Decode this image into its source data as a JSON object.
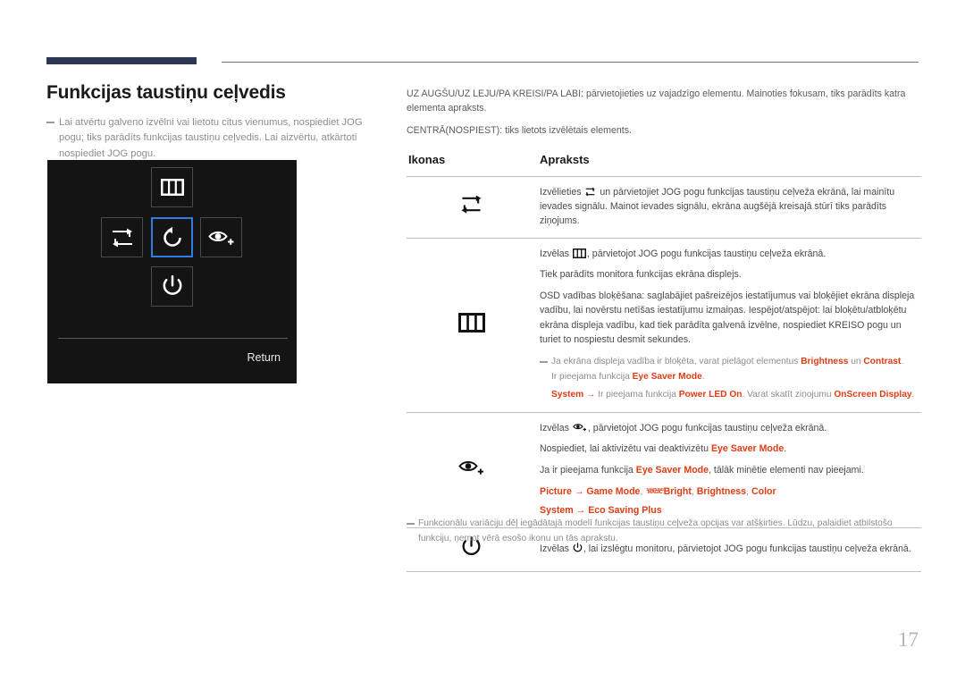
{
  "page": {
    "title": "Funkcijas taustiņu ceļvedis",
    "page_number": "17",
    "intro_note": "Lai atvērtu galveno izvēlni vai lietotu citus vienumus, nospiediet JOG pogu; tiks parādīts funkcijas taustiņu ceļvedis. Lai aizvērtu, atkārtoti nospiediet JOG pogu.",
    "accent_color": "#e03c14",
    "rule_color": "#2c3551"
  },
  "osd": {
    "return_label": "Return",
    "buttons": {
      "up": "menu-bars-icon",
      "left": "source-switch-icon",
      "center": "return-arrow-icon",
      "right": "eye-saver-icon",
      "down": "power-icon"
    },
    "highlight_color": "#2f7ddf"
  },
  "intro": {
    "line1": "UZ AUGŠU/UZ LEJU/PA KREISI/PA LABI: pārvietojieties uz vajadzīgo elementu. Mainoties fokusam, tiks parādīts katra elementa apraksts.",
    "line2": "CENTRĀ(NOSPIEST): tiks lietots izvēlētais elements."
  },
  "table": {
    "headers": {
      "icons": "Ikonas",
      "description": "Apraksts"
    },
    "rows": [
      {
        "icon": "source-switch-icon",
        "paragraphs": [
          {
            "pre": "Izvēlieties ",
            "icon": "source-switch-icon",
            "post": " un pārvietojiet JOG pogu funkcijas taustiņu ceļveža ekrānā, lai mainītu ievades signālu. Mainot ievades signālu, ekrāna augšējā kreisajā stūrī tiks parādīts ziņojums."
          }
        ]
      },
      {
        "icon": "menu-bars-icon",
        "paragraphs": [
          {
            "pre": "Izvēlas ",
            "icon": "menu-bars-icon",
            "post": ", pārvietojot JOG pogu funkcijas taustiņu ceļveža ekrānā."
          },
          {
            "text": "Tiek parādīts monitora funkcijas ekrāna displejs."
          },
          {
            "text": "OSD vadības bloķēšana: saglabājiet pašreizējos iestatījumus vai bloķējiet ekrāna displeja vadību, lai novērstu netīšas iestatījumu izmaiņas. Iespējot/atspējot: lai bloķētu/atbloķētu ekrāna displeja vadību, kad tiek parādīta galvenā izvēlne, nospiediet KREISO pogu un turiet to nospiestu desmit sekundes."
          }
        ],
        "subnote": {
          "line1_a": "Ja ekrāna displeja vadība ir bloķēta, varat pielāgot elementus ",
          "line1_hl1": "Brightness",
          "line1_b": " un ",
          "line1_hl2": "Contrast",
          "line1_c": ".",
          "line2_a": "Ir pieejama funkcija ",
          "line2_hl": "Eye Saver Mode",
          "line2_b": ".",
          "line3_hl1": "System",
          "line3_arrow": " → ",
          "line3_a": "Ir pieejama funkcija ",
          "line3_hl2": "Power LED On",
          "line3_b": ". Varat skatīt ziņojumu ",
          "line3_hl3": "OnScreen Display",
          "line3_c": "."
        }
      },
      {
        "icon": "eye-saver-icon",
        "paragraphs": [
          {
            "pre": "Izvēlas ",
            "icon": "eye-saver-icon",
            "post": ", pārvietojot JOG pogu funkcijas taustiņu ceļveža ekrānā."
          },
          {
            "pre": "Nospiediet, lai aktivizētu vai deaktivizētu ",
            "hl": "Eye Saver Mode",
            "post": "."
          },
          {
            "pre": "Ja ir pieejama funkcija ",
            "hl": "Eye Saver Mode",
            "post": ", tālāk minētie elementi nav pieejami."
          }
        ],
        "menu_lines": [
          {
            "root": "Picture",
            "arrow": " → ",
            "item1": "Game Mode",
            "sep1": ", ",
            "magic_top": "SAMSUNG",
            "magic_bottom": "MAGIC",
            "item2": "Bright",
            "sep2": ", ",
            "item3": "Brightness",
            "sep3": ", ",
            "item4": "Color"
          },
          {
            "root": "System",
            "arrow": " → ",
            "item1": "Eco Saving Plus"
          }
        ]
      },
      {
        "icon": "power-icon",
        "paragraphs": [
          {
            "pre": "Izvēlas ",
            "icon": "power-icon",
            "post": ", lai izslēgtu monitoru, pārvietojot JOG pogu funkcijas taustiņu ceļveža ekrānā."
          }
        ]
      }
    ]
  },
  "bottom_note": "Funkcionālu variāciju dēļ iegādātajā modelī funkcijas taustiņu ceļveža opcijas var atšķirties. Lūdzu, palaidiet atbilstošo funkciju, ņemot vērā esošo ikonu un tās aprakstu."
}
